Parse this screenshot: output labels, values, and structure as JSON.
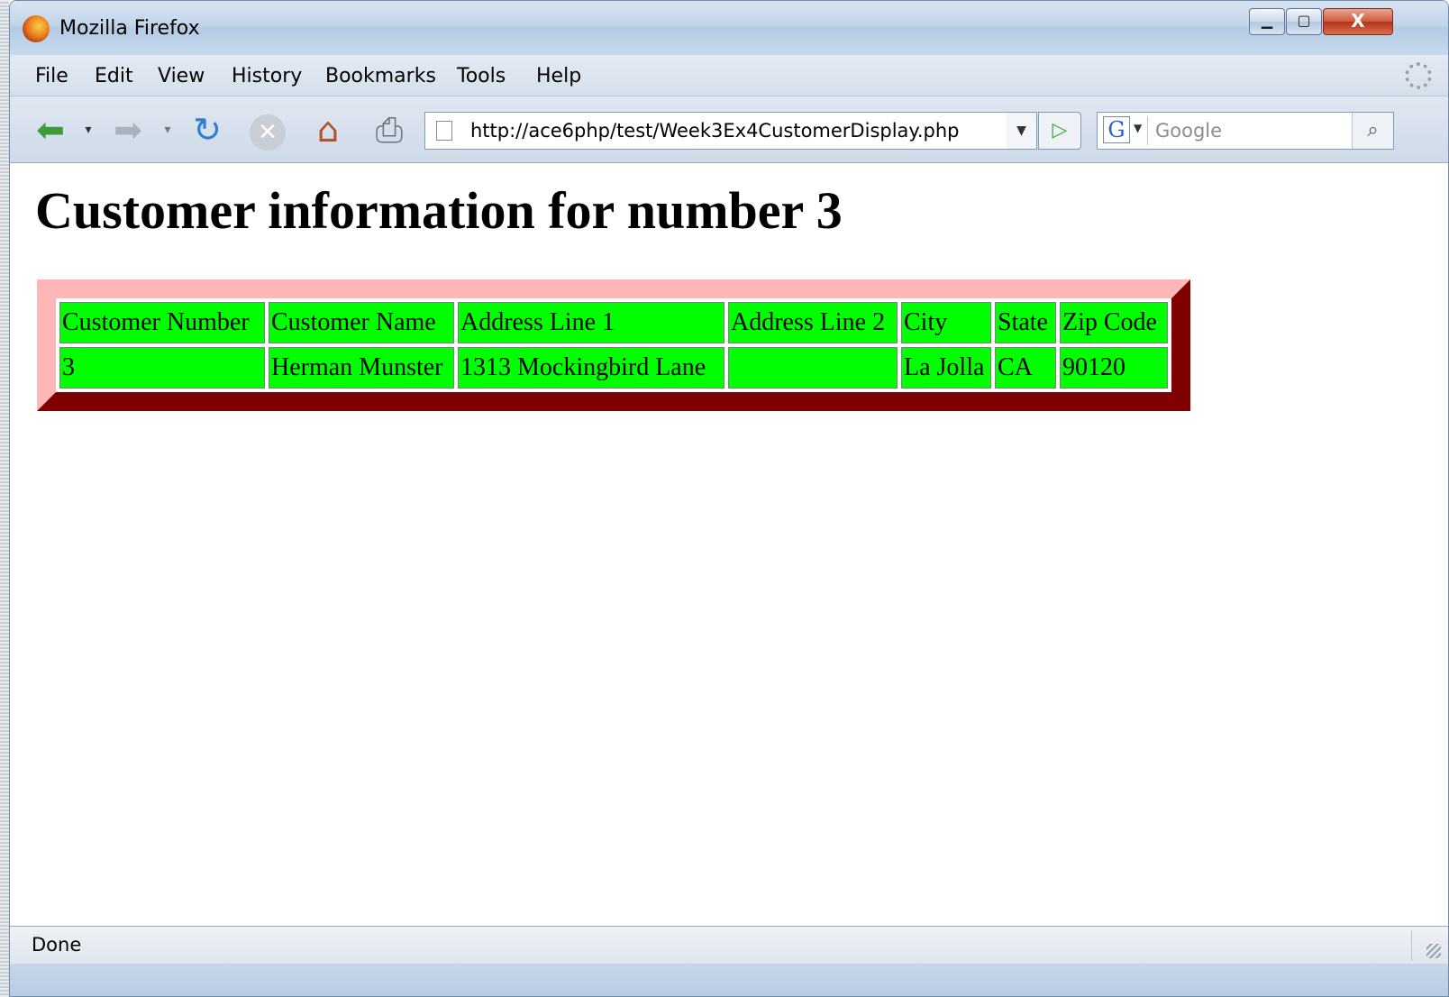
{
  "window": {
    "title": "Mozilla Firefox"
  },
  "menu": {
    "items": [
      "File",
      "Edit",
      "View",
      "History",
      "Bookmarks",
      "Tools",
      "Help"
    ]
  },
  "toolbar": {
    "url": "http://ace6php/test/Week3Ex4CustomerDisplay.php",
    "search_placeholder": "Google",
    "search_engine": "G",
    "icons": [
      "back-icon",
      "forward-icon",
      "reload-icon",
      "stop-icon",
      "home-icon",
      "print-icon",
      "go-icon",
      "search-icon"
    ]
  },
  "page": {
    "heading": "Customer information for number 3",
    "table": {
      "headers": [
        "Customer Number",
        "Customer Name",
        "Address Line 1",
        "Address Line 2",
        "City",
        "State",
        "Zip Code"
      ],
      "rows": [
        [
          "3",
          "Herman Munster",
          "1313 Mockingbird Lane",
          "",
          "La Jolla",
          "CA",
          "90120"
        ]
      ]
    },
    "colors": {
      "cell_background": "#00ff00",
      "table_border_light": "#ffb6b6",
      "table_border_dark": "#800000"
    }
  },
  "status": {
    "text": "Done"
  }
}
